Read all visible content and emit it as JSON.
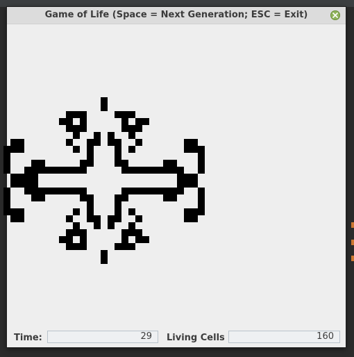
{
  "window": {
    "title": "Game of Life (Space = Next Generation; ESC = Exit)",
    "close_icon": "close-icon"
  },
  "status": {
    "time_label": "Time:",
    "time_value": "29",
    "living_label": "Living Cells",
    "living_value": "160"
  },
  "board": {
    "cell_color": "#000000",
    "background": "#eeeeee",
    "living_cells": [
      [
        25,
        12
      ],
      [
        25,
        13
      ],
      [
        20,
        14
      ],
      [
        21,
        14
      ],
      [
        22,
        14
      ],
      [
        27,
        14
      ],
      [
        28,
        14
      ],
      [
        29,
        14
      ],
      [
        19,
        15
      ],
      [
        20,
        15
      ],
      [
        22,
        15
      ],
      [
        28,
        15
      ],
      [
        30,
        15
      ],
      [
        31,
        15
      ],
      [
        20,
        16
      ],
      [
        21,
        16
      ],
      [
        22,
        16
      ],
      [
        28,
        16
      ],
      [
        29,
        16
      ],
      [
        30,
        16
      ],
      [
        21,
        17
      ],
      [
        24,
        17
      ],
      [
        26,
        17
      ],
      [
        29,
        17
      ],
      [
        12,
        18
      ],
      [
        13,
        18
      ],
      [
        20,
        18
      ],
      [
        23,
        18
      ],
      [
        24,
        18
      ],
      [
        26,
        18
      ],
      [
        27,
        18
      ],
      [
        30,
        18
      ],
      [
        37,
        18
      ],
      [
        38,
        18
      ],
      [
        11,
        19
      ],
      [
        12,
        19
      ],
      [
        13,
        19
      ],
      [
        21,
        19
      ],
      [
        23,
        19
      ],
      [
        27,
        19
      ],
      [
        29,
        19
      ],
      [
        37,
        19
      ],
      [
        38,
        19
      ],
      [
        39,
        19
      ],
      [
        11,
        20
      ],
      [
        23,
        20
      ],
      [
        27,
        20
      ],
      [
        39,
        20
      ],
      [
        11,
        21
      ],
      [
        15,
        21
      ],
      [
        16,
        21
      ],
      [
        22,
        21
      ],
      [
        23,
        21
      ],
      [
        27,
        21
      ],
      [
        28,
        21
      ],
      [
        34,
        21
      ],
      [
        35,
        21
      ],
      [
        39,
        21
      ],
      [
        11,
        22
      ],
      [
        14,
        22
      ],
      [
        15,
        22
      ],
      [
        16,
        22
      ],
      [
        17,
        22
      ],
      [
        18,
        22
      ],
      [
        19,
        22
      ],
      [
        20,
        22
      ],
      [
        21,
        22
      ],
      [
        22,
        22
      ],
      [
        28,
        22
      ],
      [
        29,
        22
      ],
      [
        30,
        22
      ],
      [
        31,
        22
      ],
      [
        32,
        22
      ],
      [
        33,
        22
      ],
      [
        34,
        22
      ],
      [
        35,
        22
      ],
      [
        36,
        22
      ],
      [
        39,
        22
      ],
      [
        12,
        23
      ],
      [
        13,
        23
      ],
      [
        14,
        23
      ],
      [
        15,
        23
      ],
      [
        36,
        23
      ],
      [
        37,
        23
      ],
      [
        38,
        23
      ],
      [
        12,
        24
      ],
      [
        13,
        24
      ],
      [
        14,
        24
      ],
      [
        15,
        24
      ],
      [
        36,
        24
      ],
      [
        37,
        24
      ],
      [
        38,
        24
      ],
      [
        11,
        25
      ],
      [
        14,
        25
      ],
      [
        15,
        25
      ],
      [
        16,
        25
      ],
      [
        17,
        25
      ],
      [
        18,
        25
      ],
      [
        19,
        25
      ],
      [
        20,
        25
      ],
      [
        21,
        25
      ],
      [
        22,
        25
      ],
      [
        28,
        25
      ],
      [
        29,
        25
      ],
      [
        30,
        25
      ],
      [
        31,
        25
      ],
      [
        32,
        25
      ],
      [
        33,
        25
      ],
      [
        34,
        25
      ],
      [
        35,
        25
      ],
      [
        36,
        25
      ],
      [
        39,
        25
      ],
      [
        11,
        26
      ],
      [
        15,
        26
      ],
      [
        16,
        26
      ],
      [
        22,
        26
      ],
      [
        23,
        26
      ],
      [
        27,
        26
      ],
      [
        28,
        26
      ],
      [
        34,
        26
      ],
      [
        35,
        26
      ],
      [
        39,
        26
      ],
      [
        11,
        27
      ],
      [
        23,
        27
      ],
      [
        27,
        27
      ],
      [
        39,
        27
      ],
      [
        11,
        28
      ],
      [
        12,
        28
      ],
      [
        13,
        28
      ],
      [
        21,
        28
      ],
      [
        23,
        28
      ],
      [
        27,
        28
      ],
      [
        29,
        28
      ],
      [
        37,
        28
      ],
      [
        38,
        28
      ],
      [
        39,
        28
      ],
      [
        12,
        29
      ],
      [
        13,
        29
      ],
      [
        20,
        29
      ],
      [
        23,
        29
      ],
      [
        24,
        29
      ],
      [
        26,
        29
      ],
      [
        27,
        29
      ],
      [
        30,
        29
      ],
      [
        37,
        29
      ],
      [
        38,
        29
      ],
      [
        21,
        30
      ],
      [
        24,
        30
      ],
      [
        26,
        30
      ],
      [
        29,
        30
      ],
      [
        20,
        31
      ],
      [
        21,
        31
      ],
      [
        22,
        31
      ],
      [
        28,
        31
      ],
      [
        29,
        31
      ],
      [
        30,
        31
      ],
      [
        19,
        32
      ],
      [
        20,
        32
      ],
      [
        22,
        32
      ],
      [
        28,
        32
      ],
      [
        30,
        32
      ],
      [
        31,
        32
      ],
      [
        20,
        33
      ],
      [
        21,
        33
      ],
      [
        22,
        33
      ],
      [
        27,
        33
      ],
      [
        28,
        33
      ],
      [
        29,
        33
      ],
      [
        25,
        34
      ],
      [
        25,
        35
      ]
    ]
  }
}
